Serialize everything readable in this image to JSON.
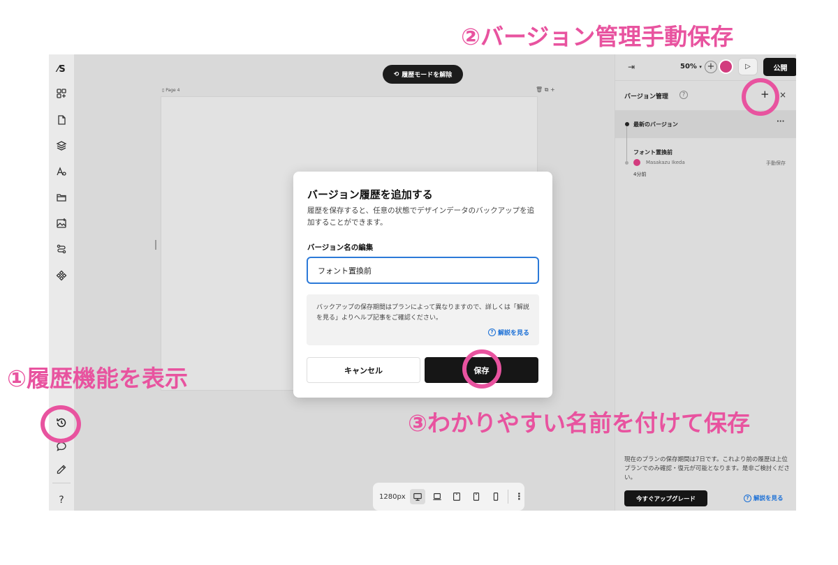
{
  "annotations": {
    "step1": "①履歴機能を表示",
    "step2": "②バージョン管理手動保存",
    "step3": "③わかりやすい名前を付けて保存"
  },
  "sidebar": {
    "logo": "⁄S",
    "help": "?"
  },
  "canvas": {
    "history_pill": "履歴モードを解除",
    "artboard_label": "Page 4",
    "artboard_tools": "🗑 ⧉ +",
    "width_label": "1280px",
    "more": "⋮"
  },
  "panel": {
    "zoom": "50%",
    "publish": "公開",
    "title": "バージョン管理",
    "add": "+",
    "close": "×",
    "latest": "最新のバージョン",
    "more": "···",
    "version": {
      "name": "フォント置換前",
      "user": "Masakazu Ikeda",
      "type": "手動保存",
      "time": "4分前"
    },
    "footer": "現在のプランの保存期間は7日です。これより前の履歴は上位プランでのみ確認・復元が可能となります。是非ご検討ください。",
    "upgrade": "今すぐアップグレード",
    "help_link": "解説を見る"
  },
  "modal": {
    "title": "バージョン履歴を追加する",
    "description": "履歴を保存すると、任意の状態でデザインデータのバックアップを追加することができます。",
    "label": "バージョン名の編集",
    "input_value": "フォント置換前",
    "note": "バックアップの保存期間はプランによって異なりますので、詳しくは「解説を見る」よりヘルプ記事をご確認ください。",
    "note_link": "解説を見る",
    "cancel": "キャンセル",
    "save": "保存"
  },
  "colors": {
    "annotation": "#e8539f",
    "primary_button": "#161616",
    "link": "#1a6fd6",
    "input_focus": "#2b79d8"
  }
}
